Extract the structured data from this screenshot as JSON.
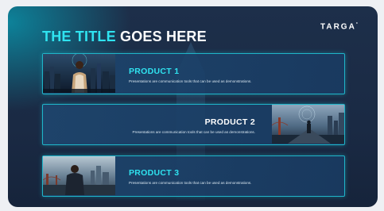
{
  "slide": {
    "title_accent": "THE TITLE",
    "title_rest": "GOES HERE",
    "logo": "TARGA",
    "logo_mark": "°"
  },
  "products": [
    {
      "title": "PRODUCT 1",
      "description": "Presentations are communication tools that can be used as demonstrations."
    },
    {
      "title": "PRODUCT 2",
      "description": "Presentations are communication tools that can be used as demonstrations."
    },
    {
      "title": "PRODUCT 3",
      "description": "Presentations are communication tools that can be used as demonstrations."
    }
  ],
  "colors": {
    "accent": "#2fe3f0",
    "panel_border": "#1fb5c9",
    "background": "#1d2f4a"
  }
}
